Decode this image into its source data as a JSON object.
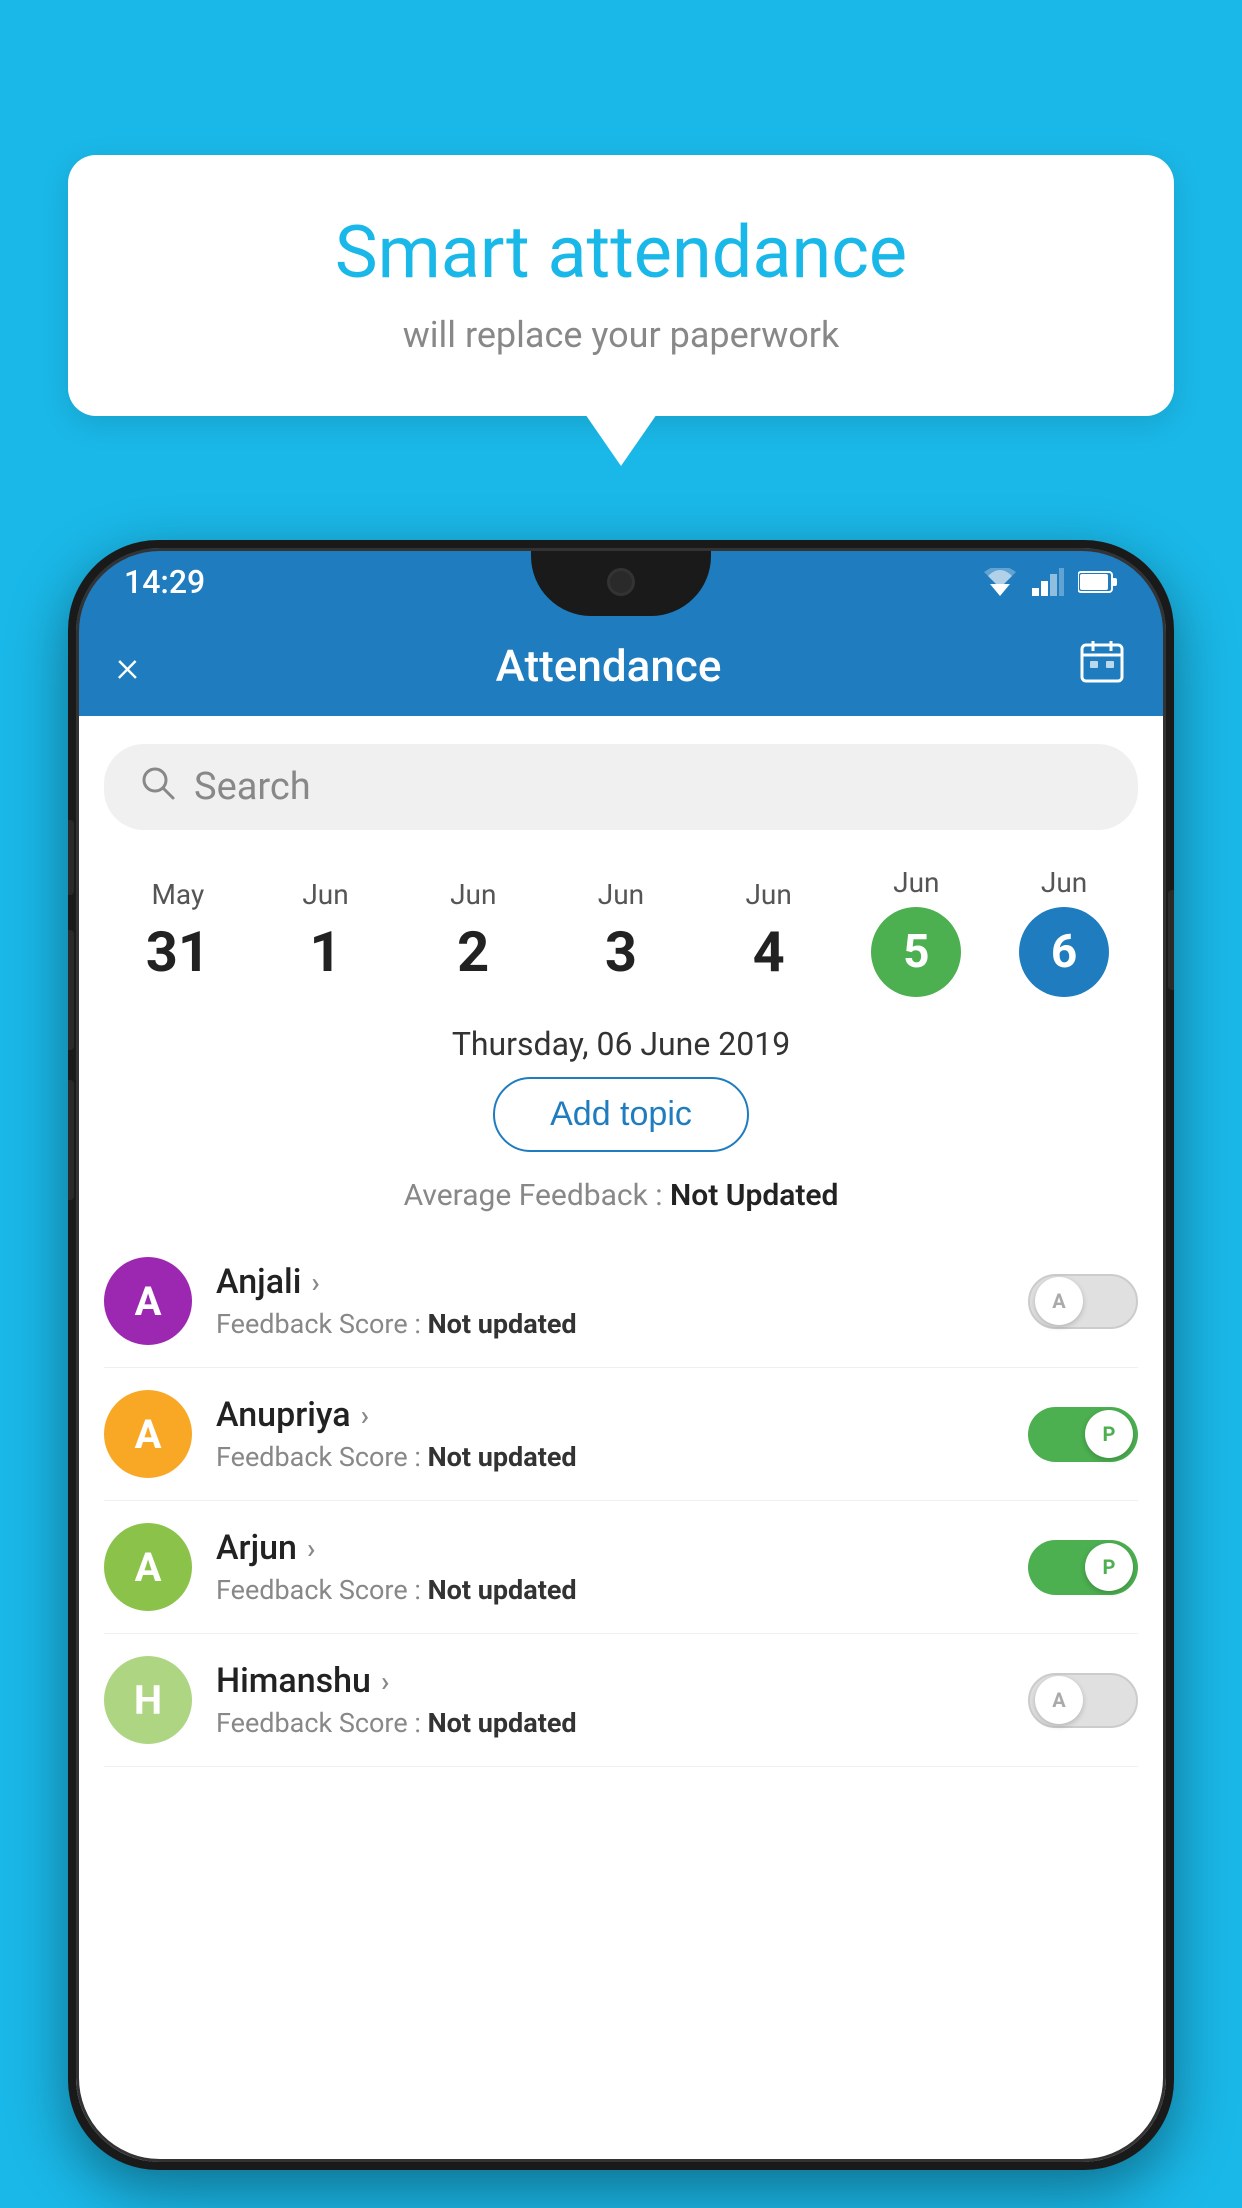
{
  "background_color": "#1ab8e8",
  "bubble": {
    "title": "Smart attendance",
    "subtitle": "will replace your paperwork"
  },
  "phone": {
    "status_time": "14:29",
    "app_header": {
      "title": "Attendance",
      "close_icon": "×",
      "calendar_icon": "📅"
    },
    "search": {
      "placeholder": "Search"
    },
    "date_strip": [
      {
        "month": "May",
        "day": "31",
        "type": "normal"
      },
      {
        "month": "Jun",
        "day": "1",
        "type": "normal"
      },
      {
        "month": "Jun",
        "day": "2",
        "type": "normal"
      },
      {
        "month": "Jun",
        "day": "3",
        "type": "normal"
      },
      {
        "month": "Jun",
        "day": "4",
        "type": "normal"
      },
      {
        "month": "Jun",
        "day": "5",
        "type": "green"
      },
      {
        "month": "Jun",
        "day": "6",
        "type": "blue"
      }
    ],
    "selected_date_label": "Thursday, 06 June 2019",
    "add_topic_label": "Add topic",
    "avg_feedback_label": "Average Feedback :",
    "avg_feedback_value": "Not Updated",
    "students": [
      {
        "name": "Anjali",
        "avatar_letter": "A",
        "avatar_color": "#9c27b0",
        "feedback_label": "Feedback Score :",
        "feedback_value": "Not updated",
        "toggle_state": "off",
        "toggle_letter": "A"
      },
      {
        "name": "Anupriya",
        "avatar_letter": "A",
        "avatar_color": "#f9a825",
        "feedback_label": "Feedback Score :",
        "feedback_value": "Not updated",
        "toggle_state": "on",
        "toggle_letter": "P"
      },
      {
        "name": "Arjun",
        "avatar_letter": "A",
        "avatar_color": "#8bc34a",
        "feedback_label": "Feedback Score :",
        "feedback_value": "Not updated",
        "toggle_state": "on",
        "toggle_letter": "P"
      },
      {
        "name": "Himanshu",
        "avatar_letter": "H",
        "avatar_color": "#aed581",
        "feedback_label": "Feedback Score :",
        "feedback_value": "Not updated",
        "toggle_state": "off",
        "toggle_letter": "A"
      }
    ]
  }
}
